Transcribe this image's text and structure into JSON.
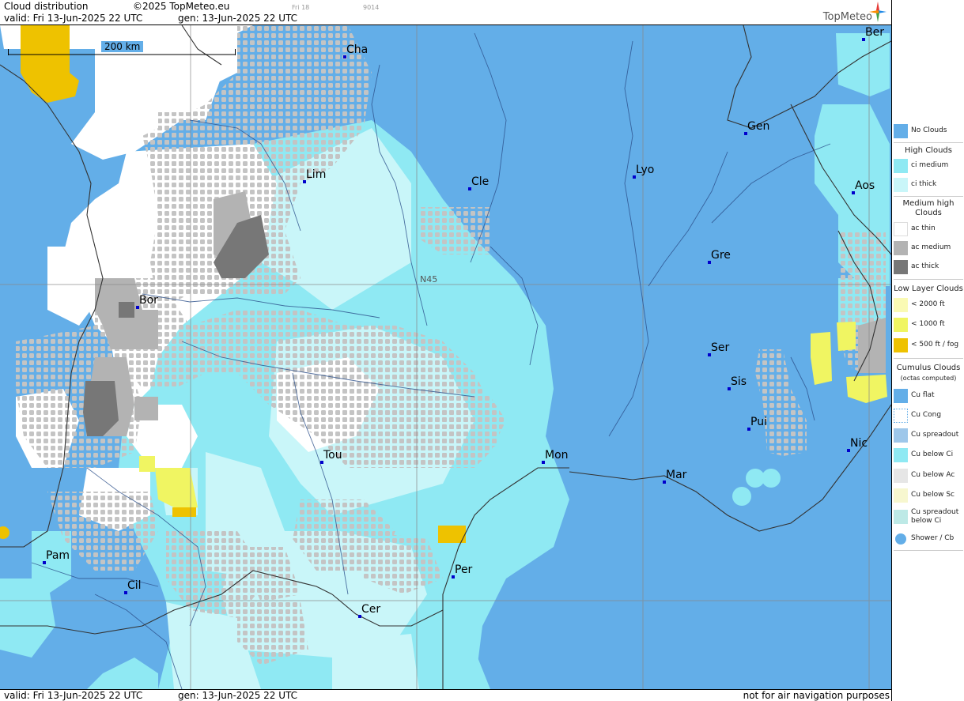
{
  "header": {
    "title": "Cloud distribution",
    "copyright": "©2025 TopMeteo.eu",
    "valid": "valid:  Fri  13-Jun-2025  22 UTC",
    "gen": "gen: 13-Jun-2025 22 UTC",
    "day_code": "Fri 18",
    "code": "9014",
    "brand": "TopMeteo"
  },
  "footer": {
    "valid": "valid:  Fri  13-Jun-2025  22 UTC",
    "gen": "gen: 13-Jun-2025 22 UTC",
    "disclaimer": "not for air navigation purposes"
  },
  "map": {
    "scale_label": "200 km",
    "lat_label": "N45",
    "cities": [
      {
        "name": "Ber"
      },
      {
        "name": "Cha"
      },
      {
        "name": "Gen"
      },
      {
        "name": "Lim"
      },
      {
        "name": "Lyo"
      },
      {
        "name": "Cle"
      },
      {
        "name": "Aos"
      },
      {
        "name": "Gre"
      },
      {
        "name": "Bor"
      },
      {
        "name": "Ser"
      },
      {
        "name": "Sis"
      },
      {
        "name": "Pui"
      },
      {
        "name": "Tou"
      },
      {
        "name": "Mon"
      },
      {
        "name": "Nic"
      },
      {
        "name": "Mar"
      },
      {
        "name": "Pam"
      },
      {
        "name": "Per"
      },
      {
        "name": "Cil"
      },
      {
        "name": "Cer"
      }
    ]
  },
  "legend": {
    "no_clouds": "No Clouds",
    "high_title": "High Clouds",
    "ci_medium": "ci medium",
    "ci_thick": "ci thick",
    "medium_title": "Medium high Clouds",
    "ac_thin": "ac thin",
    "ac_medium": "ac medium",
    "ac_thick": "ac thick",
    "low_title": "Low Layer Clouds",
    "low_2000": "< 2000 ft",
    "low_1000": "< 1000 ft",
    "low_500": "< 500 ft / fog",
    "cu_title": "Cumulus Clouds",
    "cu_sub": "(octas computed)",
    "cu_flat": "Cu flat",
    "cu_cong": "Cu Cong",
    "cu_spreadout": "Cu spreadout",
    "cu_below_ci": "Cu below Ci",
    "cu_below_ac": "Cu below Ac",
    "cu_below_sc": "Cu below Sc",
    "cu_spread_below_ci": "Cu spreadout below Ci",
    "shower": "Shower / Cb"
  },
  "colors": {
    "no_clouds": "#63aee8",
    "ci_medium": "#8fe9f3",
    "ci_thick": "#c9f6f9",
    "ac_thin": "#ffffff",
    "ac_medium": "#b3b3b3",
    "ac_thick": "#777777",
    "low_2000": "#fafab4",
    "low_1000": "#f0f562",
    "low_500": "#eec200",
    "city_marker": "#0000cc"
  }
}
